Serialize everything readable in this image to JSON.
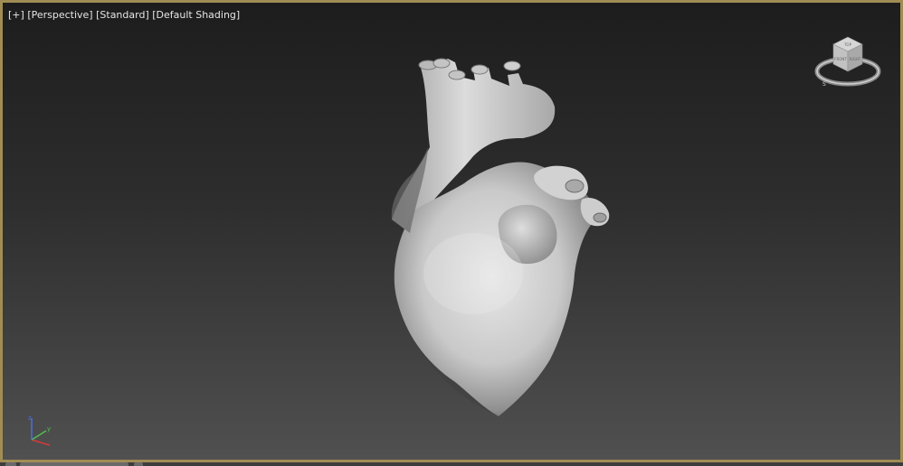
{
  "viewport": {
    "labels": {
      "plus": "[+]",
      "view": "[Perspective]",
      "style": "[Standard]",
      "shading": "[Default Shading]"
    },
    "border_color": "#a18d54",
    "active": true
  },
  "viewcube": {
    "face_top": "TOP",
    "face_front": "FRONT",
    "face_right": "RIGHT",
    "compass_south": "S"
  },
  "axis_tripod": {
    "x_color": "#d63a3a",
    "y_color": "#4fc04f",
    "z_color": "#4a6fe0",
    "y_label": "y",
    "z_label": "z"
  },
  "scene": {
    "object": "heart-model",
    "shading": "Default Shading"
  }
}
